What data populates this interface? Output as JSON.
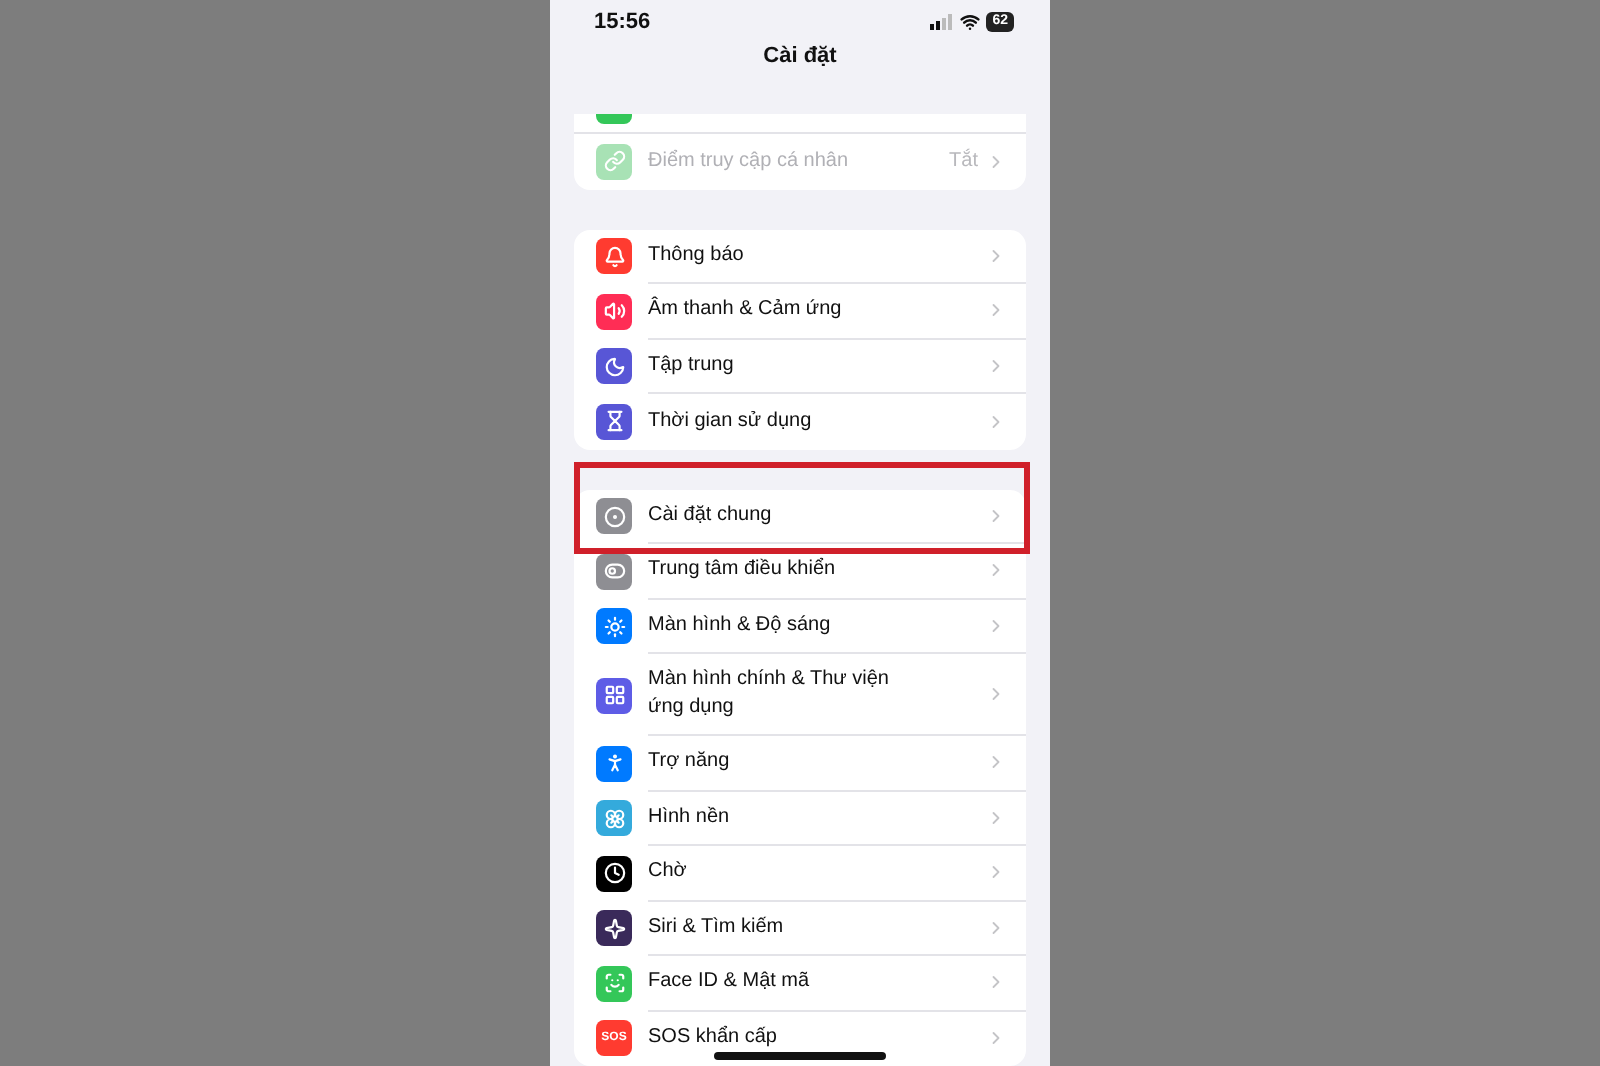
{
  "status_bar": {
    "time": "15:56",
    "battery": "62"
  },
  "title": "Cài đặt",
  "groups": [
    {
      "rows": [
        {
          "label": "Điểm truy cập cá nhân",
          "value": "Tắt",
          "color": "#a8e2b5",
          "disabled": true,
          "highlighted": false
        }
      ]
    },
    {
      "rows": [
        {
          "label": "Thông báo",
          "color": "#ff3b30",
          "disabled": false,
          "highlighted": false
        },
        {
          "label": "Âm thanh & Cảm ứng",
          "color": "#ff2d55",
          "disabled": false,
          "highlighted": false
        },
        {
          "label": "Tập trung",
          "color": "#5856d6",
          "disabled": false,
          "highlighted": false
        },
        {
          "label": "Thời gian sử dụng",
          "color": "#5856d6",
          "disabled": false,
          "highlighted": false
        }
      ]
    },
    {
      "rows": [
        {
          "label": "Cài đặt chung",
          "color": "#8e8e93",
          "disabled": false,
          "highlighted": true
        },
        {
          "label": "Trung tâm điều khiển",
          "color": "#8e8e93",
          "disabled": false,
          "highlighted": false
        },
        {
          "label": "Màn hình & Độ sáng",
          "color": "#007aff",
          "disabled": false,
          "highlighted": false
        },
        {
          "label": "Màn hình chính & Thư viện ứng dụng",
          "color": "#5e5ce6",
          "disabled": false,
          "highlighted": false
        },
        {
          "label": "Trợ năng",
          "color": "#007aff",
          "disabled": false,
          "highlighted": false
        },
        {
          "label": "Hình nền",
          "color": "#34aadc",
          "disabled": false,
          "highlighted": false
        },
        {
          "label": "Chờ",
          "color": "#000000",
          "disabled": false,
          "highlighted": false
        },
        {
          "label": "Siri & Tìm kiếm",
          "color": "#3a2a5a",
          "disabled": false,
          "highlighted": false
        },
        {
          "label": "Face ID & Mật mã",
          "color": "#34c759",
          "disabled": false,
          "highlighted": false
        },
        {
          "label": "SOS khẩn cấp",
          "icon_text": "SOS",
          "color": "#ff3b30",
          "disabled": false,
          "highlighted": false
        }
      ]
    }
  ]
}
